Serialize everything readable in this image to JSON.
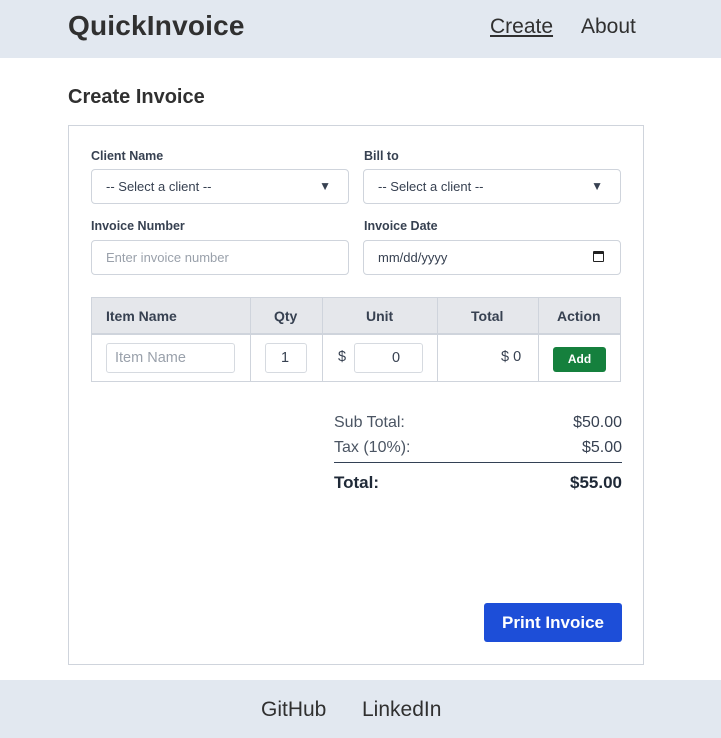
{
  "header": {
    "brand": "QuickInvoice",
    "nav": {
      "create": "Create",
      "about": "About"
    }
  },
  "page": {
    "title": "Create Invoice"
  },
  "form": {
    "client_name": {
      "label": "Client Name",
      "value": "-- Select a client --"
    },
    "bill_to": {
      "label": "Bill to",
      "value": "-- Select a client --"
    },
    "invoice_number": {
      "label": "Invoice Number",
      "placeholder": "Enter invoice number"
    },
    "invoice_date": {
      "label": "Invoice Date",
      "placeholder": "mm/dd/yyyy"
    }
  },
  "items_table": {
    "headers": {
      "item": "Item Name",
      "qty": "Qty",
      "unit": "Unit",
      "total": "Total",
      "action": "Action"
    },
    "row": {
      "item_placeholder": "Item Name",
      "qty": "1",
      "unit_symbol": "$",
      "unit": "0",
      "total": "$ 0",
      "action": "Add"
    }
  },
  "summary": {
    "subtotal_label": "Sub Total:",
    "subtotal": "$50.00",
    "tax_label": "Tax (10%):",
    "tax": "$5.00",
    "total_label": "Total:",
    "total": "$55.00"
  },
  "actions": {
    "print": "Print Invoice"
  },
  "footer": {
    "github": "GitHub",
    "linkedin": "LinkedIn"
  },
  "colors": {
    "header_bg": "#e2e8f0",
    "add_button": "#15803d",
    "print_button": "#1d4ed8"
  }
}
